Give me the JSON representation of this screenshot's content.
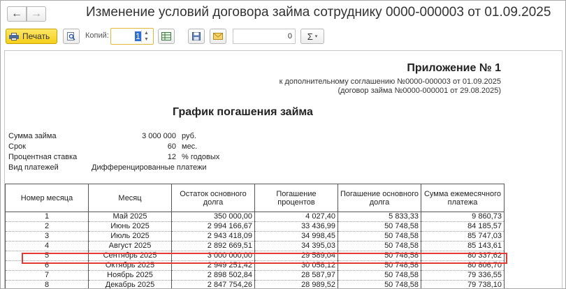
{
  "window": {
    "title": "Изменение условий договора займа сотруднику 0000-000003 от 01.09.2025",
    "nav": {
      "back": "←",
      "forward": "→"
    }
  },
  "toolbar": {
    "print_label": "Печать",
    "copies_label": "Копий:",
    "copies_value": "1",
    "sum_value": "0",
    "sigma_label": "Σ",
    "sigma_arrow": "▾"
  },
  "document": {
    "appendix_title": "Приложение № 1",
    "appendix_line1": "к дополнительному соглашению №0000-000003 от 01.09.2025",
    "appendix_line2": "(договор займа №0000-000001 от 29.08.2025)",
    "heading": "График погашения займа",
    "info": [
      {
        "label": "Сумма займа",
        "value": "3 000 000",
        "unit": "руб."
      },
      {
        "label": "Срок",
        "value": "60",
        "unit": "мес."
      },
      {
        "label": "Процентная ставка",
        "value": "12",
        "unit": "% годовых"
      },
      {
        "label": "Вид платежей",
        "value": "Дифференцированные платежи",
        "unit": ""
      }
    ],
    "table": {
      "headers": [
        "Номер месяца",
        "Месяц",
        "Остаток основного долга",
        "Погашение процентов",
        "Погашение основного долга",
        "Сумма ежемесячного платежа"
      ],
      "rows": [
        [
          "1",
          "Май 2025",
          "350 000,00",
          "4 027,40",
          "5 833,33",
          "9 860,73"
        ],
        [
          "2",
          "Июнь 2025",
          "2 994 166,67",
          "33 436,99",
          "50 748,58",
          "84 185,57"
        ],
        [
          "3",
          "Июль 2025",
          "2 943 418,09",
          "34 998,45",
          "50 748,58",
          "85 747,03"
        ],
        [
          "4",
          "Август 2025",
          "2 892 669,51",
          "34 395,03",
          "50 748,58",
          "85 143,61"
        ],
        [
          "5",
          "Сентябрь 2025",
          "3 000 000,00",
          "29 589,04",
          "50 748,58",
          "80 337,62"
        ],
        [
          "6",
          "Октябрь 2025",
          "2 949 251,42",
          "30 058,12",
          "50 748,58",
          "80 806,70"
        ],
        [
          "7",
          "Ноябрь 2025",
          "2 898 502,84",
          "28 587,97",
          "50 748,58",
          "79 336,55"
        ],
        [
          "8",
          "Декабрь 2025",
          "2 847 754,26",
          "28 989,52",
          "50 748,58",
          "79 738,10"
        ]
      ],
      "highlighted_row": 5
    }
  },
  "colors": {
    "print_button": "#f5cf1a",
    "highlight": "#e53935",
    "copies_border": "#e2b93b"
  }
}
